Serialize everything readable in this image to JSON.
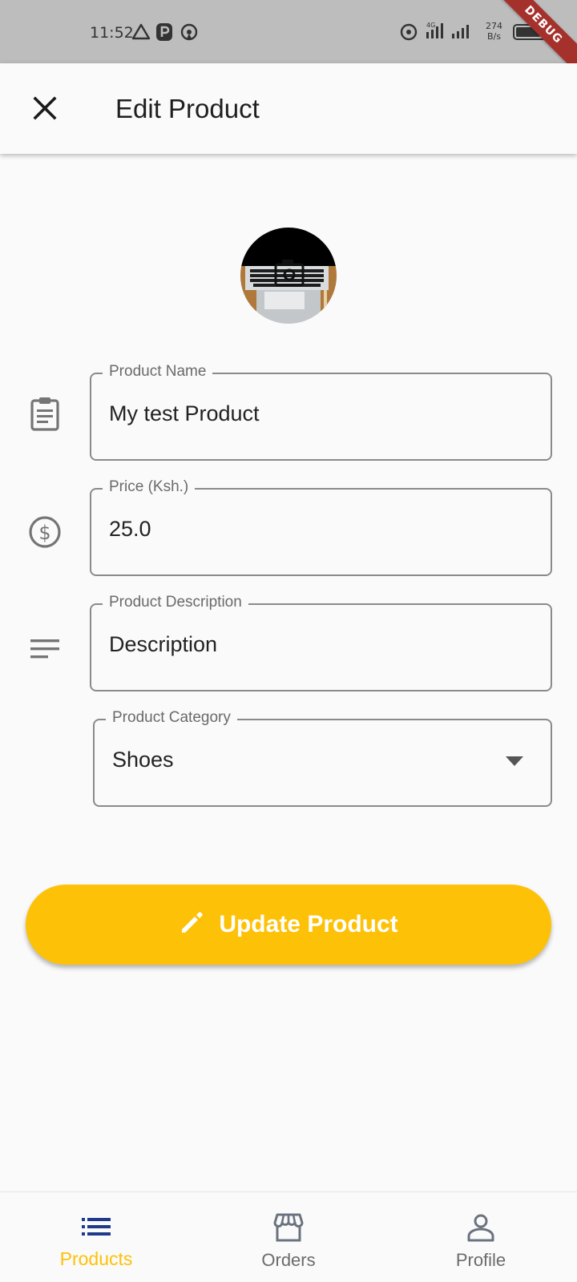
{
  "status_bar": {
    "time": "11:52",
    "net_speed_value": "274",
    "net_speed_unit": "B/s",
    "debug_banner": "DEBUG"
  },
  "app_bar": {
    "title": "Edit Product",
    "close_icon": "close-icon"
  },
  "form": {
    "product_name": {
      "label": "Product Name",
      "value": "My test Product",
      "icon": "clipboard-icon"
    },
    "price": {
      "label": "Price (Ksh.)",
      "value": "25.0",
      "icon": "dollar-icon"
    },
    "description": {
      "label": "Product Description",
      "value": "Description",
      "icon": "notes-icon"
    },
    "category": {
      "label": "Product Category",
      "value": "Shoes",
      "icon": "dropdown-caret-icon"
    }
  },
  "update_button": {
    "label": "Update Product",
    "icon": "pencil-icon"
  },
  "bottom_nav": {
    "items": [
      {
        "label": "Products",
        "icon": "list-icon",
        "active": true
      },
      {
        "label": "Orders",
        "icon": "store-icon",
        "active": false
      },
      {
        "label": "Profile",
        "icon": "person-icon",
        "active": false
      }
    ]
  },
  "colors": {
    "accent": "#fdc107",
    "nav_active_icon": "#1f3a8a",
    "debug_banner": "#a5312c",
    "status_bar": "#bdbdbd"
  }
}
